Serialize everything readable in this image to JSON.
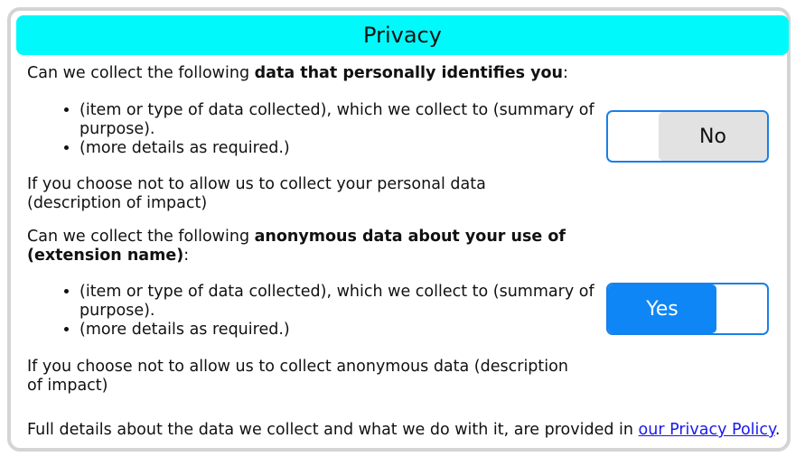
{
  "title": "Privacy",
  "personal": {
    "question_prefix": "Can we collect the following ",
    "question_bold": "data that personally identifies you",
    "question_suffix": ":",
    "items": [
      "(item or type of data collected), which we collect to (summary of purpose).",
      "(more details as required.)"
    ],
    "impact": "If you choose not to allow us to collect your personal data (description of impact)",
    "toggle_label": "No",
    "toggle_state": "off"
  },
  "anonymous": {
    "question_prefix": "Can we collect the following ",
    "question_bold": "anonymous data about your use of (extension name)",
    "question_suffix": ":",
    "items": [
      "(item or type of data collected), which we collect to (summary of purpose).",
      "(more details as required.)"
    ],
    "impact": "If you choose not to allow us to collect anonymous data (description of impact)",
    "toggle_label": "Yes",
    "toggle_state": "on"
  },
  "footer": {
    "text": "Full details about the data we collect and what we do with it, are provided in ",
    "link_text": "our Privacy Policy",
    "suffix": "."
  },
  "colors": {
    "title_bar": "#00f9fb",
    "toggle_on": "#0f86f5",
    "toggle_off": "#e2e2e2",
    "link": "#1a1aee"
  }
}
